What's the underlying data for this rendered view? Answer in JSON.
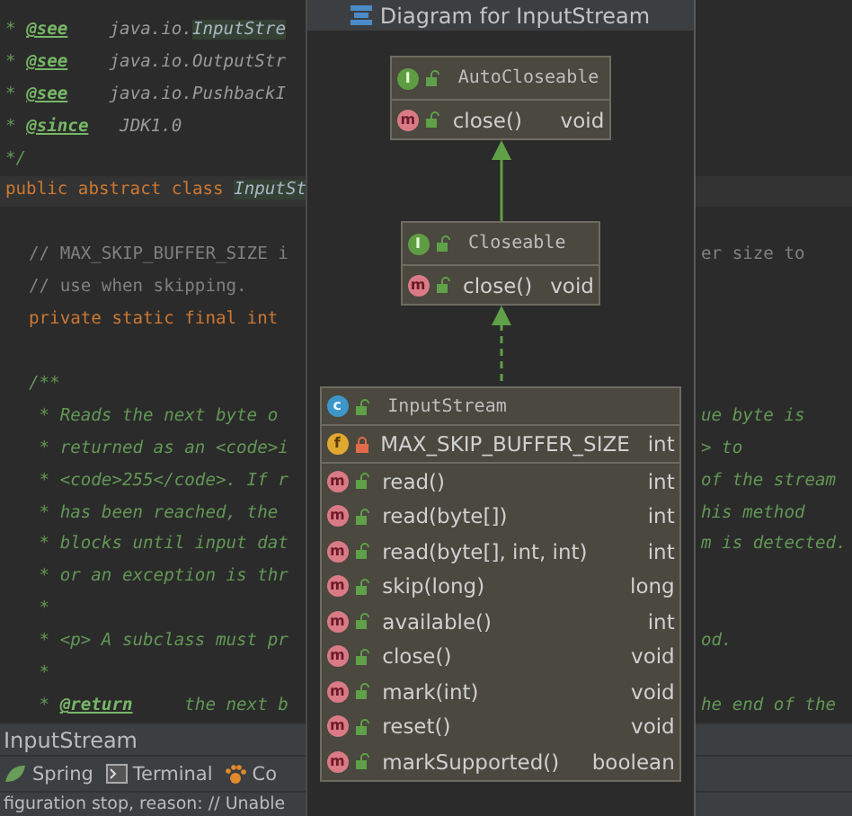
{
  "editor": {
    "lines": [
      {
        "kind": "code",
        "indent": false,
        "current": false,
        "left": [
          {
            "kind": "doc",
            "text": "* "
          },
          {
            "kind": "tag",
            "text": "@see"
          },
          {
            "kind": "ref",
            "text": "    java.io."
          },
          {
            "kind": "match",
            "text": "InputStre"
          }
        ]
      },
      {
        "kind": "code",
        "indent": false,
        "current": false,
        "left": [
          {
            "kind": "doc",
            "text": "* "
          },
          {
            "kind": "tag",
            "text": "@see"
          },
          {
            "kind": "ref",
            "text": "    java.io.OutputStr"
          }
        ]
      },
      {
        "kind": "code",
        "indent": false,
        "current": false,
        "left": [
          {
            "kind": "doc",
            "text": "* "
          },
          {
            "kind": "tag",
            "text": "@see"
          },
          {
            "kind": "ref",
            "text": "    java.io.PushbackI"
          }
        ]
      },
      {
        "kind": "code",
        "indent": false,
        "current": false,
        "left": [
          {
            "kind": "doc",
            "text": "* "
          },
          {
            "kind": "tag",
            "text": "@since"
          },
          {
            "kind": "ref",
            "text": "   JDK1.0"
          }
        ]
      },
      {
        "kind": "code",
        "indent": false,
        "current": false,
        "left": [
          {
            "kind": "doc",
            "text": "*/"
          }
        ]
      },
      {
        "kind": "code",
        "indent": false,
        "current": true,
        "left": [
          {
            "kind": "keyword",
            "text": "public abstract class "
          },
          {
            "kind": "match",
            "text": "InputSt"
          }
        ]
      },
      {
        "kind": "blank"
      },
      {
        "kind": "code",
        "indent": true,
        "current": false,
        "left": [
          {
            "kind": "comment",
            "text": "// MAX_SKIP_BUFFER_SIZE i"
          }
        ],
        "right": [
          {
            "kind": "comment",
            "text": "er size to"
          }
        ]
      },
      {
        "kind": "code",
        "indent": true,
        "current": false,
        "left": [
          {
            "kind": "comment",
            "text": "// use when skipping."
          }
        ]
      },
      {
        "kind": "code",
        "indent": true,
        "current": false,
        "left": [
          {
            "kind": "keyword",
            "text": "private static final int"
          }
        ]
      },
      {
        "kind": "blank"
      },
      {
        "kind": "code",
        "indent": true,
        "current": false,
        "left": [
          {
            "kind": "doc",
            "text": "/**"
          }
        ]
      },
      {
        "kind": "code",
        "indent": true,
        "current": false,
        "left": [
          {
            "kind": "doc",
            "text": " * Reads the next byte o"
          }
        ],
        "right": [
          {
            "kind": "doc",
            "text": "ue byte is"
          }
        ]
      },
      {
        "kind": "code",
        "indent": true,
        "current": false,
        "left": [
          {
            "kind": "doc",
            "text": " * returned as an <code>i"
          }
        ],
        "right": [
          {
            "kind": "doc",
            "text": "> to"
          }
        ]
      },
      {
        "kind": "code",
        "indent": true,
        "current": false,
        "left": [
          {
            "kind": "doc",
            "text": " * <code>255</code>. If r"
          }
        ],
        "right": [
          {
            "kind": "doc",
            "text": "of the stream"
          }
        ]
      },
      {
        "kind": "code",
        "indent": true,
        "current": false,
        "left": [
          {
            "kind": "doc",
            "text": " * has been reached, the"
          }
        ],
        "right": [
          {
            "kind": "doc",
            "text": "his method"
          }
        ]
      },
      {
        "kind": "code",
        "indent": true,
        "current": false,
        "left": [
          {
            "kind": "doc",
            "text": " * blocks until input dat"
          }
        ],
        "right": [
          {
            "kind": "doc",
            "text": "m is detected."
          }
        ]
      },
      {
        "kind": "code",
        "indent": true,
        "current": false,
        "left": [
          {
            "kind": "doc",
            "text": " * or an exception is thr"
          }
        ]
      },
      {
        "kind": "code",
        "indent": true,
        "current": false,
        "left": [
          {
            "kind": "doc",
            "text": " *"
          }
        ]
      },
      {
        "kind": "code",
        "indent": true,
        "current": false,
        "left": [
          {
            "kind": "doc",
            "text": " * <p> A subclass must pr"
          }
        ],
        "right": [
          {
            "kind": "doc",
            "text": "od."
          }
        ]
      },
      {
        "kind": "code",
        "indent": true,
        "current": false,
        "left": [
          {
            "kind": "doc",
            "text": " *"
          }
        ]
      },
      {
        "kind": "code",
        "indent": true,
        "current": false,
        "left": [
          {
            "kind": "doc",
            "text": " * "
          },
          {
            "kind": "tag",
            "text": "@return"
          },
          {
            "kind": "doc",
            "text": "     the next b"
          }
        ],
        "right": [
          {
            "kind": "doc",
            "text": "he end of the"
          }
        ]
      }
    ]
  },
  "diagram": {
    "title": "Diagram for InputStream",
    "nodes": [
      {
        "name": "AutoCloseable",
        "badge": "I",
        "kind": "interface",
        "methods": [
          {
            "name": "close()",
            "type": "void",
            "badge": "m",
            "locked": false
          }
        ]
      },
      {
        "name": "Closeable",
        "badge": "I",
        "kind": "interface",
        "methods": [
          {
            "name": "close()",
            "type": "void",
            "badge": "m",
            "locked": false
          }
        ]
      },
      {
        "name": "InputStream",
        "badge": "c",
        "kind": "class",
        "fields": [
          {
            "name": "MAX_SKIP_BUFFER_SIZE",
            "type": "int",
            "badge": "f",
            "locked": true
          }
        ],
        "methods": [
          {
            "name": "read()",
            "type": "int",
            "badge": "m",
            "locked": false
          },
          {
            "name": "read(byte[])",
            "type": "int",
            "badge": "m",
            "locked": false
          },
          {
            "name": "read(byte[], int, int)",
            "type": "int",
            "badge": "m",
            "locked": false
          },
          {
            "name": "skip(long)",
            "type": "long",
            "badge": "m",
            "locked": false
          },
          {
            "name": "available()",
            "type": "int",
            "badge": "m",
            "locked": false
          },
          {
            "name": "close()",
            "type": "void",
            "badge": "m",
            "locked": false
          },
          {
            "name": "mark(int)",
            "type": "void",
            "badge": "m",
            "locked": false
          },
          {
            "name": "reset()",
            "type": "void",
            "badge": "m",
            "locked": false
          },
          {
            "name": "markSupported()",
            "type": "boolean",
            "badge": "m",
            "locked": false
          }
        ]
      }
    ],
    "edges": [
      {
        "kind": "extends"
      },
      {
        "kind": "implements"
      }
    ]
  },
  "bottom_panel": {
    "title": "InputStream",
    "tool_tabs": [
      {
        "label": "Spring",
        "kind": "spring"
      },
      {
        "label": "Terminal",
        "kind": "terminal"
      },
      {
        "label": "Co",
        "kind": "paw"
      }
    ],
    "status": "figuration stop, reason: // Unable"
  }
}
